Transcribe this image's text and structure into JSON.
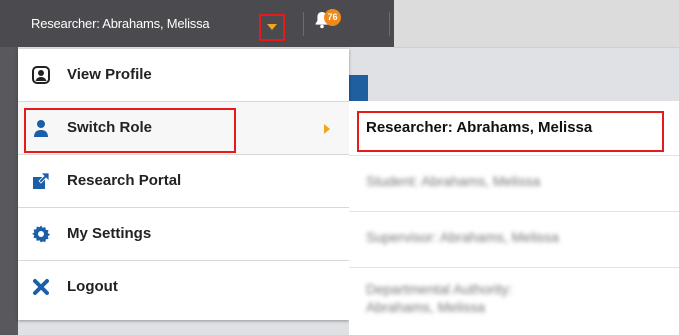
{
  "topbar": {
    "user_label": "Researcher: Abrahams, Melissa",
    "notification_count": "76"
  },
  "menu": {
    "items": [
      {
        "label": "View Profile",
        "icon": "user-circle-icon"
      },
      {
        "label": "Switch Role",
        "icon": "user-icon",
        "active": true
      },
      {
        "label": "Research Portal",
        "icon": "external-link-icon"
      },
      {
        "label": "My Settings",
        "icon": "gear-icon"
      },
      {
        "label": "Logout",
        "icon": "close-icon"
      }
    ]
  },
  "submenu": {
    "items": [
      {
        "label": "Researcher: Abrahams, Melissa"
      },
      {
        "label": "Student: Abrahams, Melissa"
      },
      {
        "label": "Supervisor: Abrahams, Melissa"
      },
      {
        "label": "Departmental Authority:",
        "label2": "Abrahams, Melissa"
      }
    ]
  },
  "colors": {
    "topbar": "#4b4b4f",
    "accent_orange": "#f5a51c",
    "highlight_red": "#e51b1b",
    "icon_blue": "#1a5fa8"
  }
}
